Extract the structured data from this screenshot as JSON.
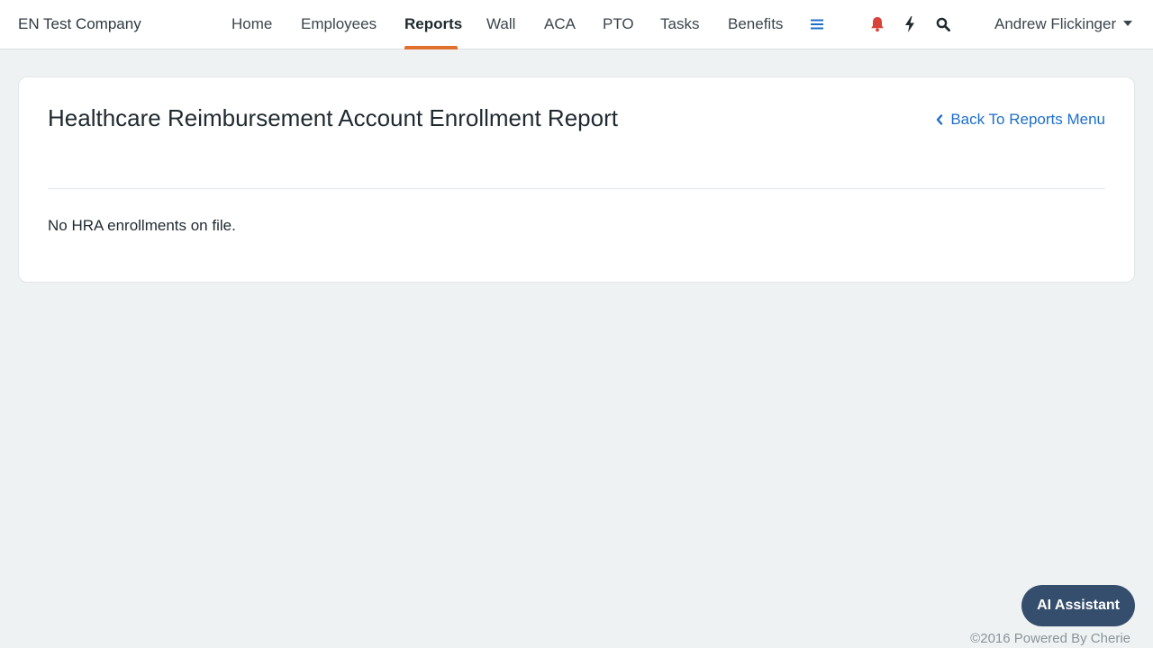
{
  "brand": "EN Test Company",
  "nav": {
    "items": [
      {
        "label": "Home"
      },
      {
        "label": "Employees"
      },
      {
        "label": "Reports"
      },
      {
        "label": "Wall"
      },
      {
        "label": "ACA"
      },
      {
        "label": "PTO"
      },
      {
        "label": "Tasks"
      },
      {
        "label": "Benefits"
      }
    ],
    "active": "Reports",
    "more_icon": "hamburger-menu-icon",
    "icons": [
      "bell-icon",
      "lightning-icon",
      "search-icon"
    ],
    "user": "Andrew Flickinger"
  },
  "colors": {
    "accent": "#e0702e",
    "link": "#1e6fc9",
    "bell": "#d9423b",
    "ai_button": "#364e6e",
    "background": "#eff2f3"
  },
  "report": {
    "title": "Healthcare Reimbursement Account Enrollment Report",
    "back_label": "Back To Reports Menu",
    "empty_message": "No HRA enrollments on file."
  },
  "ai_assistant_label": "AI Assistant",
  "footer": "©2016 Powered By Cherie"
}
